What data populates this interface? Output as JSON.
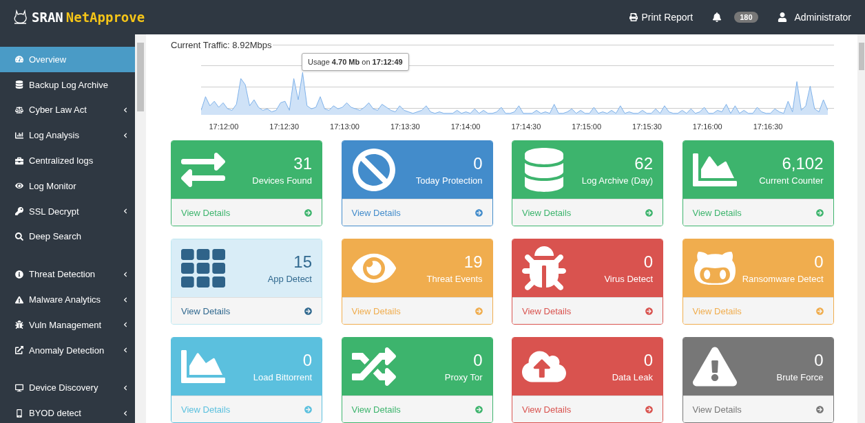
{
  "header": {
    "brand_first": "SRAN",
    "brand_second": "NetApprove",
    "print": "Print Report",
    "notifications": "180",
    "user": "Administrator"
  },
  "sidebar": {
    "groups": [
      [
        {
          "label": "Overview",
          "selected": true,
          "submenu": false
        },
        {
          "label": "Backup Log Archive",
          "selected": false,
          "submenu": false
        },
        {
          "label": "Cyber Law Act",
          "selected": false,
          "submenu": true
        },
        {
          "label": "Log Analysis",
          "selected": false,
          "submenu": true
        },
        {
          "label": "Centralized logs",
          "selected": false,
          "submenu": false
        },
        {
          "label": "Log Monitor",
          "selected": false,
          "submenu": false
        },
        {
          "label": "SSL Decrypt",
          "selected": false,
          "submenu": true
        },
        {
          "label": "Deep Search",
          "selected": false,
          "submenu": false
        }
      ],
      [
        {
          "label": "Threat Detection",
          "selected": false,
          "submenu": true
        },
        {
          "label": "Malware Analytics",
          "selected": false,
          "submenu": true
        },
        {
          "label": "Vuln Management",
          "selected": false,
          "submenu": true
        },
        {
          "label": "Anomaly Detection",
          "selected": false,
          "submenu": true
        }
      ],
      [
        {
          "label": "Device Discovery",
          "selected": false,
          "submenu": true
        },
        {
          "label": "BYOD detect",
          "selected": false,
          "submenu": true
        }
      ]
    ]
  },
  "traffic": {
    "title": "Current Traffic: 8.92Mbps",
    "tooltip": "Usage **4.70 Mb** on **17:12:49**",
    "x_labels": [
      "17:12:00",
      "17:12:30",
      "17:13:00",
      "17:13:30",
      "17:14:00",
      "17:14:30",
      "17:15:00",
      "17:15:30",
      "17:16:00",
      "17:16:30"
    ]
  },
  "cards": [
    {
      "value": "31",
      "label": "Devices Found",
      "link": "View Details",
      "color": "#3db46d",
      "kind": "solid"
    },
    {
      "value": "0",
      "label": "Today Protection",
      "link": "View Details",
      "color": "#438ccb",
      "kind": "solid"
    },
    {
      "value": "62",
      "label": "Log Archive (Day)",
      "link": "View Details",
      "color": "#3db46d",
      "kind": "solid"
    },
    {
      "value": "6,102",
      "label": "Current Counter",
      "link": "View Details",
      "color": "#3db46d",
      "kind": "solid"
    },
    {
      "value": "15",
      "label": "App Detect",
      "link": "View Details",
      "color": "#31698f",
      "kind": "light"
    },
    {
      "value": "19",
      "label": "Threat Events",
      "link": "View Details",
      "color": "#f0ad4e",
      "kind": "solid"
    },
    {
      "value": "0",
      "label": "Virus Detect",
      "link": "View Details",
      "color": "#d9534f",
      "kind": "solid"
    },
    {
      "value": "0",
      "label": "Ransomware Detect",
      "link": "View Details",
      "color": "#f0ad4e",
      "kind": "solid"
    },
    {
      "value": "0",
      "label": "Load Bittorrent",
      "link": "View Details",
      "color": "#5bc0de",
      "kind": "solid"
    },
    {
      "value": "0",
      "label": "Proxy Tor",
      "link": "View Details",
      "color": "#3db46d",
      "kind": "solid"
    },
    {
      "value": "0",
      "label": "Data Leak",
      "link": "View Details",
      "color": "#d9534f",
      "kind": "solid"
    },
    {
      "value": "0",
      "label": "Brute Force",
      "link": "View Details",
      "color": "#777777",
      "kind": "solid"
    }
  ]
}
